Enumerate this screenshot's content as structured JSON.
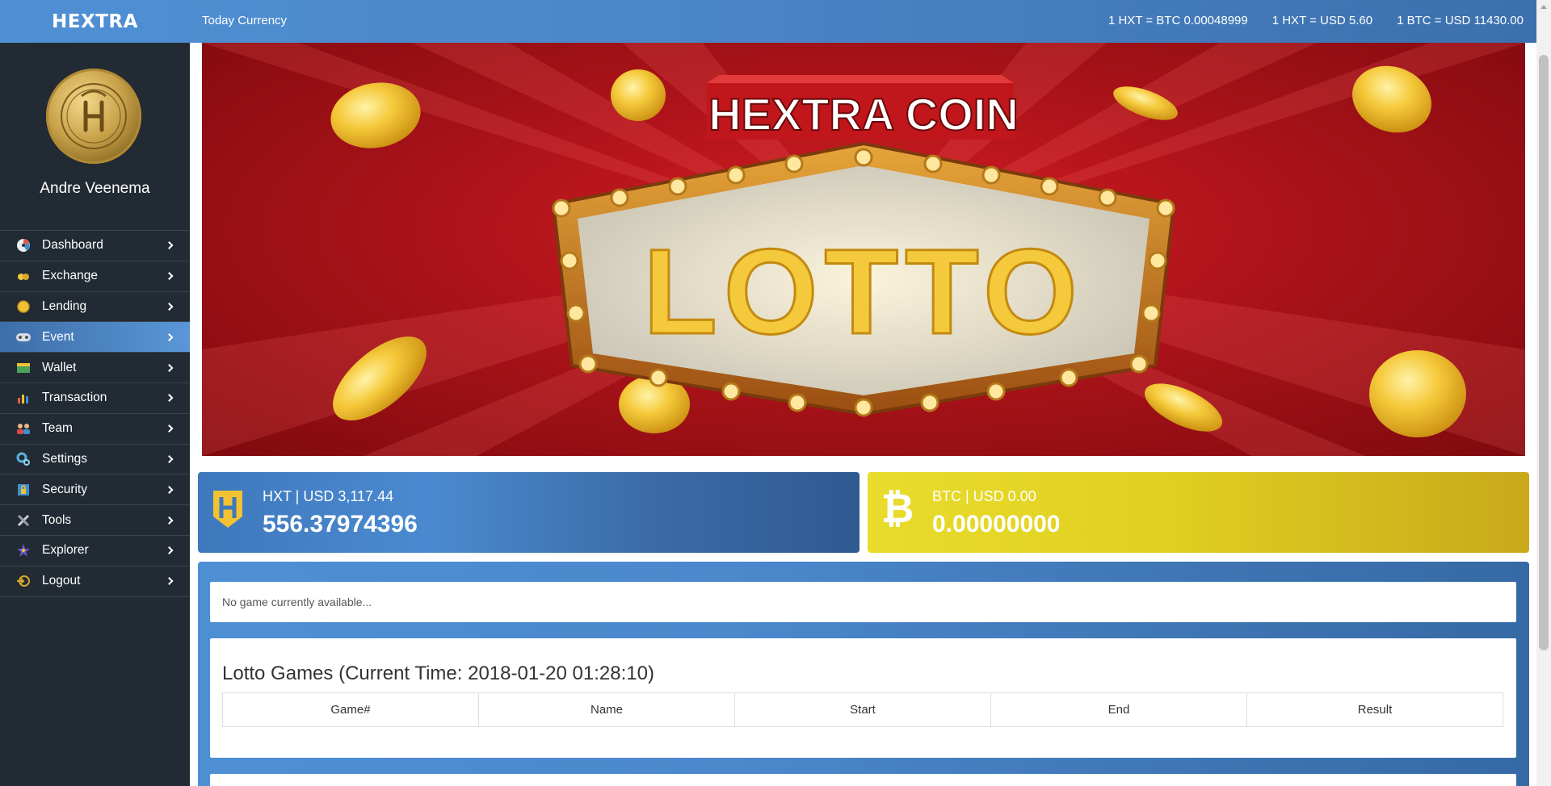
{
  "topbar": {
    "brand": "HEXTRA",
    "today_label": "Today Currency",
    "rates": [
      "1 HXT = BTC 0.00048999",
      "1 HXT = USD 5.60",
      "1 BTC = USD 11430.00"
    ]
  },
  "sidebar": {
    "username": "Andre Veenema",
    "items": [
      {
        "label": "Dashboard",
        "icon": "dashboard-icon"
      },
      {
        "label": "Exchange",
        "icon": "exchange-icon"
      },
      {
        "label": "Lending",
        "icon": "lending-icon"
      },
      {
        "label": "Event",
        "icon": "event-icon",
        "active": true
      },
      {
        "label": "Wallet",
        "icon": "wallet-icon"
      },
      {
        "label": "Transaction",
        "icon": "transaction-icon"
      },
      {
        "label": "Team",
        "icon": "team-icon"
      },
      {
        "label": "Settings",
        "icon": "settings-icon"
      },
      {
        "label": "Security",
        "icon": "security-icon"
      },
      {
        "label": "Tools",
        "icon": "tools-icon"
      },
      {
        "label": "Explorer",
        "icon": "explorer-icon"
      },
      {
        "label": "Logout",
        "icon": "logout-icon"
      }
    ]
  },
  "banner": {
    "title": "HEXTRA COIN",
    "headline": "LOTTO"
  },
  "cards": {
    "hxt": {
      "title": "HXT | USD 3,117.44",
      "value": "556.37974396",
      "icon": "hextra-logo-icon",
      "color": "#3e78bd"
    },
    "btc": {
      "title": "BTC | USD 0.00",
      "value": "0.00000000",
      "icon": "bitcoin-icon",
      "color": "#e2d123"
    }
  },
  "main": {
    "notice": "No game currently available...",
    "games_title": "Lotto Games (Current Time: 2018-01-20 01:28:10)",
    "columns": [
      "Game#",
      "Name",
      "Start",
      "End",
      "Result"
    ]
  },
  "colors": {
    "accent": "#4a88cc",
    "sidebar_bg": "#222a33",
    "active_menu": "#5a97d8",
    "banner_red": "#b0141a",
    "gold": "#f2c94c"
  }
}
